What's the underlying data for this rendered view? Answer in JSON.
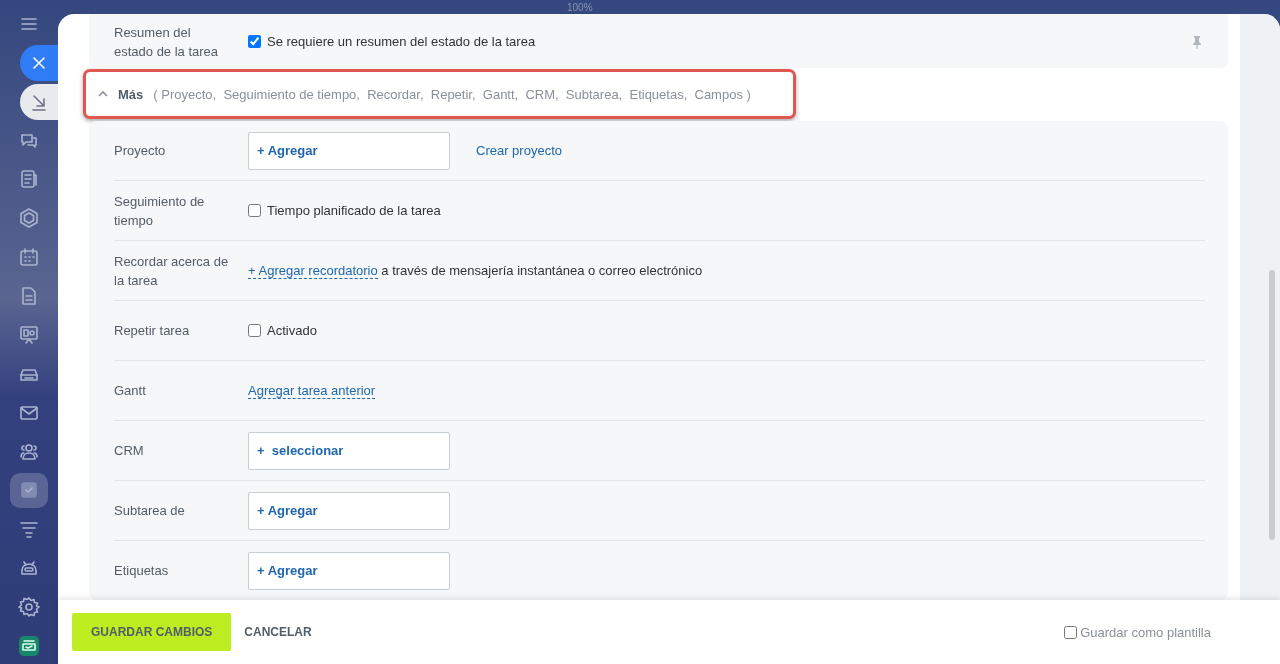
{
  "zoom_label": "100%",
  "sidebar": {
    "items": [
      {
        "kind": "menu",
        "selected": false
      },
      {
        "kind": "close",
        "selected": false
      },
      {
        "kind": "collapse",
        "selected": false
      },
      {
        "kind": "chat",
        "selected": false
      },
      {
        "kind": "news",
        "selected": false
      },
      {
        "kind": "hexagon",
        "selected": false
      },
      {
        "kind": "calendar",
        "selected": false
      },
      {
        "kind": "document",
        "selected": false
      },
      {
        "kind": "board",
        "selected": false
      },
      {
        "kind": "drive",
        "selected": false
      },
      {
        "kind": "mail",
        "selected": false
      },
      {
        "kind": "people",
        "selected": false
      },
      {
        "kind": "task",
        "selected": true
      },
      {
        "kind": "funnel",
        "selected": false
      },
      {
        "kind": "robot",
        "selected": false
      },
      {
        "kind": "settings",
        "selected": false
      },
      {
        "kind": "app",
        "selected": false
      }
    ]
  },
  "summary": {
    "label": "Resumen del estado de la tarea",
    "checkbox": "Se requiere un resumen del estado de la tarea",
    "checked": true
  },
  "more": {
    "title": "Más",
    "list": "( Proyecto,  Seguimiento de tiempo,  Recordar,  Repetir,  Gantt,  CRM,  Subtarea,  Etiquetas,  Campos )",
    "expanded": true
  },
  "rows": [
    {
      "label": "Proyecto",
      "kind": "add_button",
      "button": "+ Agregar",
      "link": "Crear proyecto"
    },
    {
      "label": "Seguimiento de tiempo",
      "kind": "checkbox",
      "text": "Tiempo planificado de la tarea",
      "checked": false
    },
    {
      "label": "Recordar acerca de la tarea",
      "kind": "reminder",
      "link": "+ Agregar recordatorio",
      "text": "a través de mensajería instantánea o correo electrónico"
    },
    {
      "label": "Repetir tarea",
      "kind": "checkbox",
      "text": "Activado",
      "checked": false
    },
    {
      "label": "Gantt",
      "kind": "link",
      "link": "Agregar tarea anterior"
    },
    {
      "label": "CRM",
      "kind": "add_button",
      "button": "+  seleccionar"
    },
    {
      "label": "Subtarea de",
      "kind": "add_button",
      "button": "+ Agregar"
    },
    {
      "label": "Etiquetas",
      "kind": "add_button",
      "button": "+ Agregar"
    }
  ],
  "footer": {
    "save": "GUARDAR CAMBIOS",
    "cancel": "CANCELAR",
    "template": "Guardar como plantilla",
    "template_checked": false
  }
}
